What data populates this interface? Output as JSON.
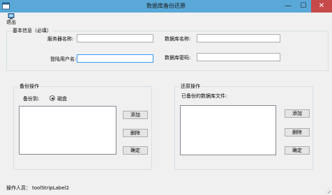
{
  "window": {
    "title": "数据库备份还原",
    "min_glyph": "—",
    "max_glyph": "☐",
    "close_glyph": "✕"
  },
  "toolbar": {
    "exit_label": "退出"
  },
  "basic_info": {
    "title": "基本信息（必填）",
    "server_name_label": "服务器名称:",
    "server_name_value": "",
    "db_name_label": "数据库名称:",
    "db_name_value": "",
    "login_user_label": "登陆用户名:",
    "login_user_value": "",
    "db_password_label": "数据库密码:",
    "db_password_value": ""
  },
  "backup": {
    "title": "备份操作",
    "backup_to_label": "备份到:",
    "disk_option": "磁盘",
    "disk_selected": true,
    "add_label": "添加",
    "delete_label": "删除",
    "confirm_label": "确定"
  },
  "restore": {
    "title": "还原操作",
    "files_label": "已备份的数据库文件:",
    "add_label": "添加",
    "delete_label": "删除",
    "confirm_label": "确定"
  },
  "status": {
    "operator_label": "操作人员：",
    "operator_value": "toolStripLabel2"
  },
  "colors": {
    "titlebar": "#5aa8d8",
    "close_button": "#c74a4a",
    "window_bg": "#f0f0f0",
    "focus_border": "#3399ff"
  }
}
